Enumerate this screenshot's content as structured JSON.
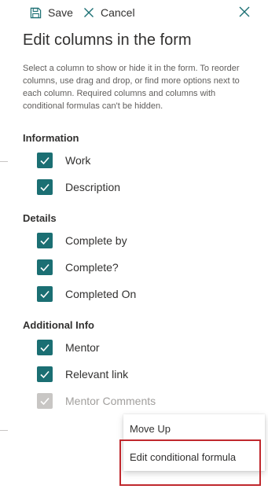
{
  "toolbar": {
    "save_label": "Save",
    "cancel_label": "Cancel",
    "save_icon": "save-icon",
    "cancel_icon": "cancel-icon",
    "close_icon": "close-icon"
  },
  "panel": {
    "title": "Edit columns in the form",
    "description": "Select a column to show or hide it in the form. To reorder columns, use drag and drop, or find more options next to each column. Required columns and columns with conditional formulas can't be hidden."
  },
  "sections": [
    {
      "header": "Information",
      "items": [
        {
          "label": "Work",
          "checked": true,
          "disabled": false
        },
        {
          "label": "Description",
          "checked": true,
          "disabled": false
        }
      ]
    },
    {
      "header": "Details",
      "items": [
        {
          "label": "Complete by",
          "checked": true,
          "disabled": false
        },
        {
          "label": "Complete?",
          "checked": true,
          "disabled": false
        },
        {
          "label": "Completed On",
          "checked": true,
          "disabled": false
        }
      ]
    },
    {
      "header": "Additional Info",
      "items": [
        {
          "label": "Mentor",
          "checked": true,
          "disabled": false
        },
        {
          "label": "Relevant link",
          "checked": true,
          "disabled": false
        },
        {
          "label": "Mentor Comments",
          "checked": true,
          "disabled": true
        }
      ]
    }
  ],
  "context_menu": {
    "items": [
      "Move Up",
      "Edit conditional formula"
    ]
  },
  "colors": {
    "checkbox_checked": "#1b6f73",
    "checkbox_disabled": "#c8c6c4",
    "highlight": "#c0282d",
    "accent": "#1b6f73"
  }
}
